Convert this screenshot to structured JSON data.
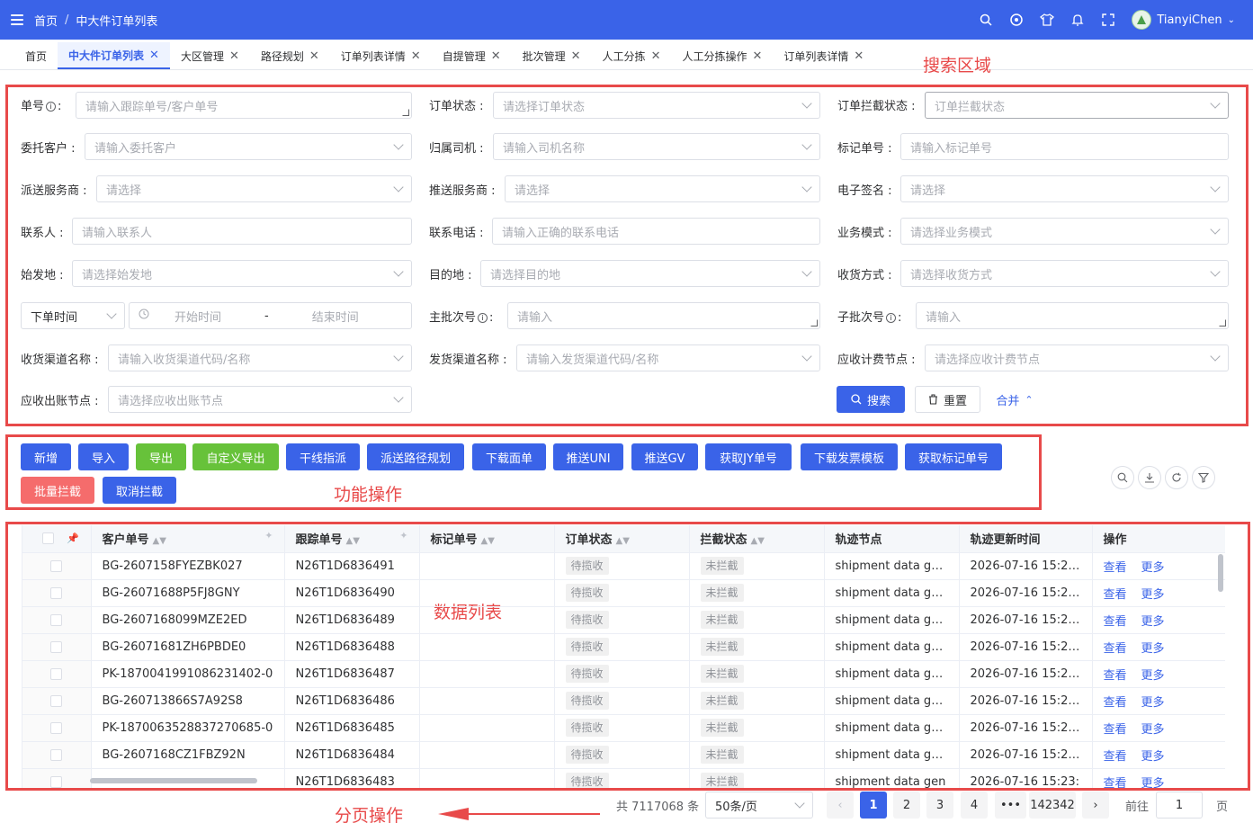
{
  "header": {
    "breadcrumb_home": "首页",
    "breadcrumb_sep": "/",
    "breadcrumb_current": "中大件订单列表",
    "username": "TianyiChen"
  },
  "tabs": [
    {
      "label": "首页",
      "closable": false
    },
    {
      "label": "中大件订单列表",
      "closable": true,
      "active": true
    },
    {
      "label": "大区管理",
      "closable": true
    },
    {
      "label": "路径规划",
      "closable": true
    },
    {
      "label": "订单列表详情",
      "closable": true
    },
    {
      "label": "自提管理",
      "closable": true
    },
    {
      "label": "批次管理",
      "closable": true
    },
    {
      "label": "人工分拣",
      "closable": true
    },
    {
      "label": "人工分拣操作",
      "closable": true
    },
    {
      "label": "订单列表详情",
      "closable": true
    }
  ],
  "annotations": {
    "search_area": "搜索区域",
    "functions": "功能操作",
    "data_list": "数据列表",
    "pagination": "分页操作"
  },
  "form": {
    "order_no_label": "单号",
    "order_no_ph": "请输入跟踪单号/客户单号",
    "order_status_label": "订单状态 :",
    "order_status_ph": "请选择订单状态",
    "intercept_label": "订单拦截状态 :",
    "intercept_ph": "订单拦截状态",
    "client_label": "委托客户 :",
    "client_ph": "请输入委托客户",
    "driver_label": "归属司机 :",
    "driver_ph": "请输入司机名称",
    "mark_label": "标记单号 :",
    "mark_ph": "请输入标记单号",
    "dispatch_label": "派送服务商 :",
    "dispatch_ph": "请选择",
    "push_label": "推送服务商 :",
    "push_ph": "请选择",
    "esign_label": "电子签名 :",
    "esign_ph": "请选择",
    "contact_label": "联系人 :",
    "contact_ph": "请输入联系人",
    "phone_label": "联系电话 :",
    "phone_ph": "请输入正确的联系电话",
    "biz_label": "业务模式 :",
    "biz_ph": "请选择业务模式",
    "origin_label": "始发地 :",
    "origin_ph": "请选择始发地",
    "dest_label": "目的地 :",
    "dest_ph": "请选择目的地",
    "recv_label": "收货方式 :",
    "recv_ph": "请选择收货方式",
    "time_type": "下单时间",
    "start_ph": "开始时间",
    "range_sep": "-",
    "end_ph": "结束时间",
    "master_label": "主批次号",
    "master_ph": "请输入",
    "sub_label": "子批次号",
    "sub_ph": "请输入",
    "recv_channel_label": "收货渠道名称 :",
    "recv_channel_ph": "请输入收货渠道代码/名称",
    "send_channel_label": "发货渠道名称 :",
    "send_channel_ph": "请输入发货渠道代码/名称",
    "fee_node_label": "应收计费节点 :",
    "fee_node_ph": "请选择应收计费节点",
    "bill_node_label": "应收出账节点 :",
    "bill_node_ph": "请选择应收出账节点",
    "search_btn": "搜索",
    "reset_btn": "重置",
    "collapse_btn": "合并"
  },
  "actions": {
    "add": "新增",
    "import": "导入",
    "export": "导出",
    "custom_export": "自定义导出",
    "trunk_assign": "干线指派",
    "route_plan": "派送路径规划",
    "download_label": "下载面单",
    "push_uni": "推送UNI",
    "push_gv": "推送GV",
    "get_jy": "获取JY单号",
    "invoice_tpl": "下载发票模板",
    "get_mark": "获取标记单号",
    "batch_intercept": "批量拦截",
    "cancel_intercept": "取消拦截"
  },
  "table": {
    "headers": [
      "客户单号",
      "跟踪单号",
      "标记单号",
      "订单状态",
      "拦截状态",
      "轨迹节点",
      "轨迹更新时间",
      "操作"
    ],
    "op_view": "查看",
    "op_more": "更多",
    "rows": [
      {
        "customer": "BG-2607158FYEZBK027",
        "tracking": "N26T1D6836491",
        "mark": "",
        "status": "待揽收",
        "intercept": "未拦截",
        "node": "shipment data gen...",
        "time": "2026-07-16 15:24:..."
      },
      {
        "customer": "BG-26071688P5FJ8GNY",
        "tracking": "N26T1D6836490",
        "mark": "",
        "status": "待揽收",
        "intercept": "未拦截",
        "node": "shipment data gen...",
        "time": "2026-07-16 15:24:..."
      },
      {
        "customer": "BG-2607168099MZE2ED",
        "tracking": "N26T1D6836489",
        "mark": "",
        "status": "待揽收",
        "intercept": "未拦截",
        "node": "shipment data gen...",
        "time": "2026-07-16 15:24:..."
      },
      {
        "customer": "BG-26071681ZH6PBDE0",
        "tracking": "N26T1D6836488",
        "mark": "",
        "status": "待揽收",
        "intercept": "未拦截",
        "node": "shipment data gen...",
        "time": "2026-07-16 15:24:..."
      },
      {
        "customer": "PK-1870041991086231402-0",
        "tracking": "N26T1D6836487",
        "mark": "",
        "status": "待揽收",
        "intercept": "未拦截",
        "node": "shipment data gen...",
        "time": "2026-07-16 15:24:..."
      },
      {
        "customer": "BG-260713866S7A92S8",
        "tracking": "N26T1D6836486",
        "mark": "",
        "status": "待揽收",
        "intercept": "未拦截",
        "node": "shipment data gen...",
        "time": "2026-07-16 15:24:..."
      },
      {
        "customer": "PK-1870063528837270685-0",
        "tracking": "N26T1D6836485",
        "mark": "",
        "status": "待揽收",
        "intercept": "未拦截",
        "node": "shipment data gen...",
        "time": "2026-07-16 15:23:..."
      },
      {
        "customer": "BG-2607168CZ1FBZ92N",
        "tracking": "N26T1D6836484",
        "mark": "",
        "status": "待揽收",
        "intercept": "未拦截",
        "node": "shipment data gen...",
        "time": "2026-07-16 15:23:..."
      },
      {
        "customer": "",
        "tracking": "N26T1D6836483",
        "mark": "",
        "status": "待揽收",
        "intercept": "未拦截",
        "node": "shipment data gen",
        "time": "2026-07-16 15:23:"
      }
    ]
  },
  "pagination": {
    "total": "共 7117068 条",
    "page_size": "50条/页",
    "pages": [
      "1",
      "2",
      "3",
      "4",
      "•••",
      "142342"
    ],
    "goto_label": "前往",
    "goto_value": "1",
    "page_unit": "页"
  },
  "colors": {
    "primary": "#3a63e8",
    "success": "#67c23a",
    "danger": "#f56c6c",
    "annotation": "#e84a4a"
  }
}
